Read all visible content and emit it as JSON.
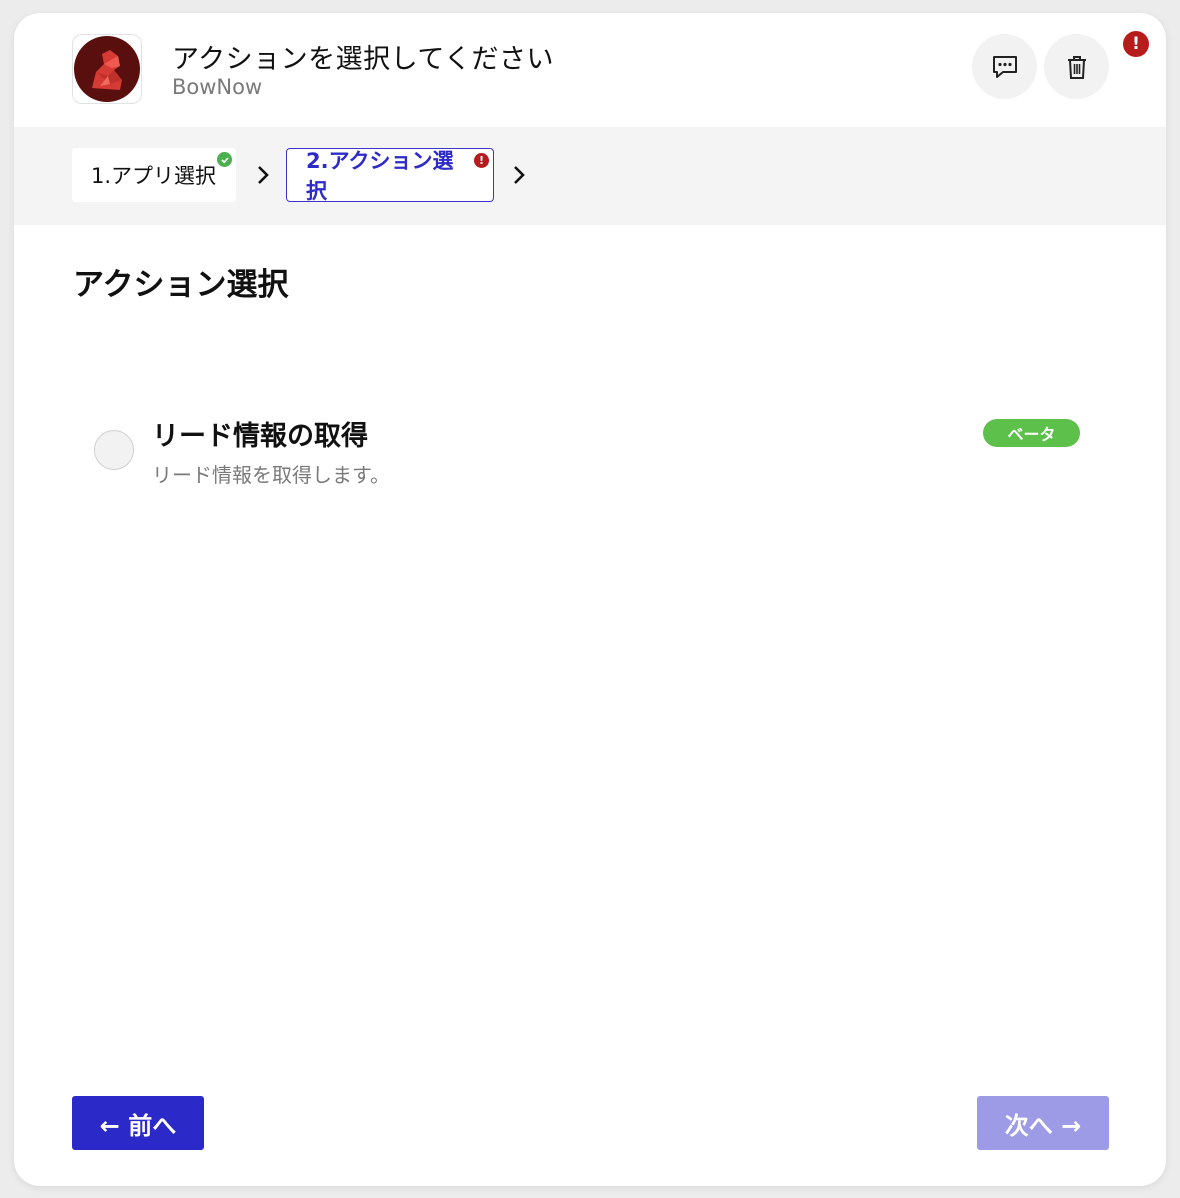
{
  "header": {
    "title": "アクションを選択してください",
    "app_name": "BowNow",
    "alert_badge": "!"
  },
  "steps": [
    {
      "label": "1.アプリ選択",
      "status": "complete",
      "status_color": "#4caf50"
    },
    {
      "label": "2.アクション選択",
      "status": "error",
      "status_color": "#b71c1c",
      "status_mark": "!"
    }
  ],
  "main": {
    "section_title": "アクション選択",
    "actions": [
      {
        "name": "リード情報の取得",
        "description": "リード情報を取得します。",
        "badge": "ベータ",
        "selected": false
      }
    ]
  },
  "footer": {
    "prev_label": "← 前へ",
    "next_label": "次へ →"
  },
  "colors": {
    "primary": "#2c29c9",
    "primary_disabled": "#9d9be6",
    "beta_badge": "#5cc04a",
    "alert": "#b71c1c",
    "success": "#4caf50"
  },
  "icons": [
    "bownow-logo-icon",
    "comment-icon",
    "trash-icon",
    "chevron-right-icon",
    "check-icon",
    "alert-icon"
  ]
}
